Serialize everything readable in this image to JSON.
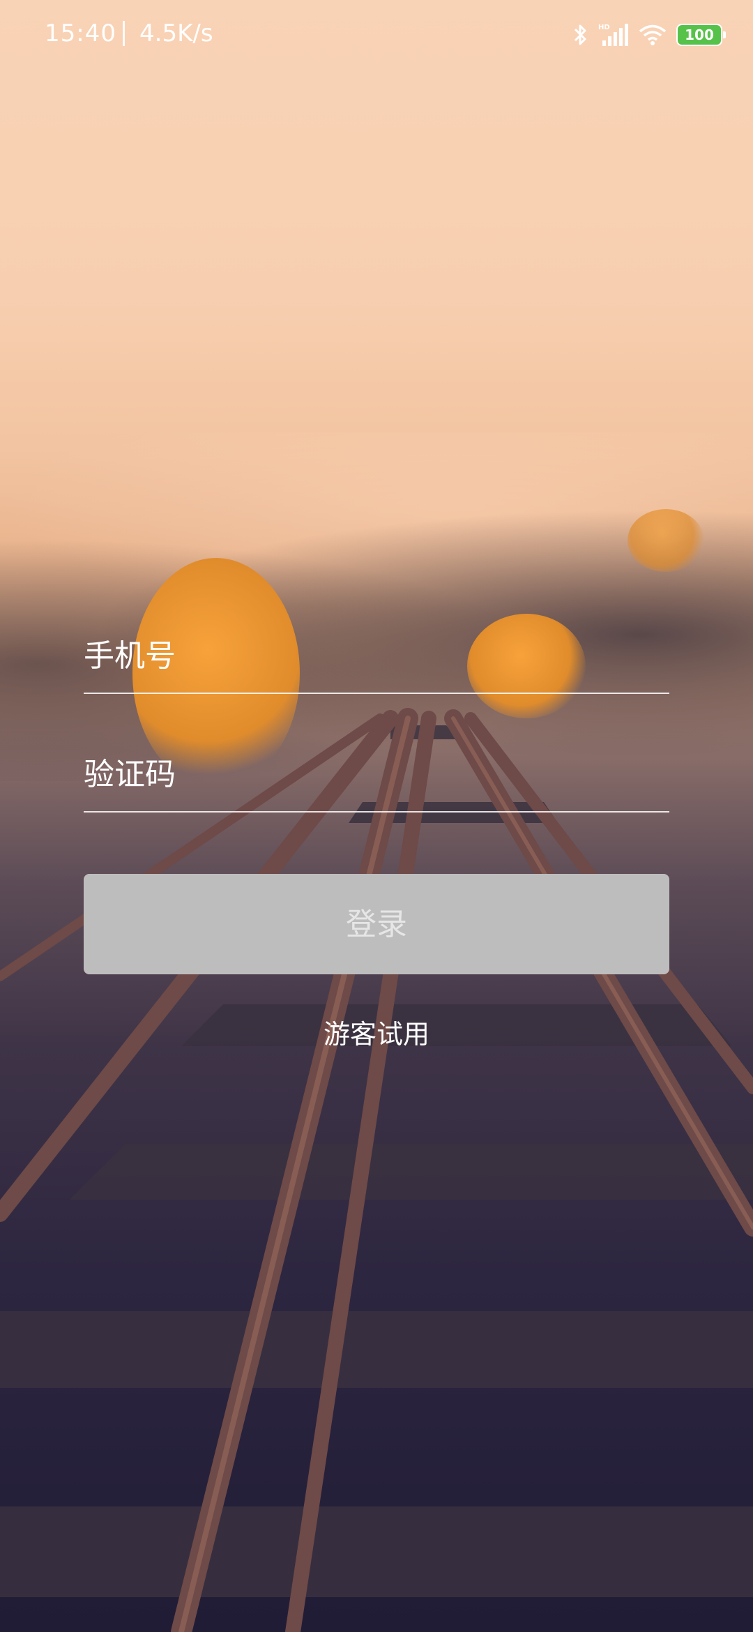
{
  "status_bar": {
    "time": "15:40",
    "network_speed": "4.5K/s",
    "battery_level": "100",
    "icons": [
      "bluetooth-icon",
      "hd-signal-icon",
      "wifi-icon",
      "battery-icon"
    ]
  },
  "login_form": {
    "phone_placeholder": "手机号",
    "code_placeholder": "验证码",
    "login_button": "登录",
    "guest_link": "游客试用"
  },
  "colors": {
    "button_bg": "#bdbdbd",
    "battery": "#57c24a"
  }
}
